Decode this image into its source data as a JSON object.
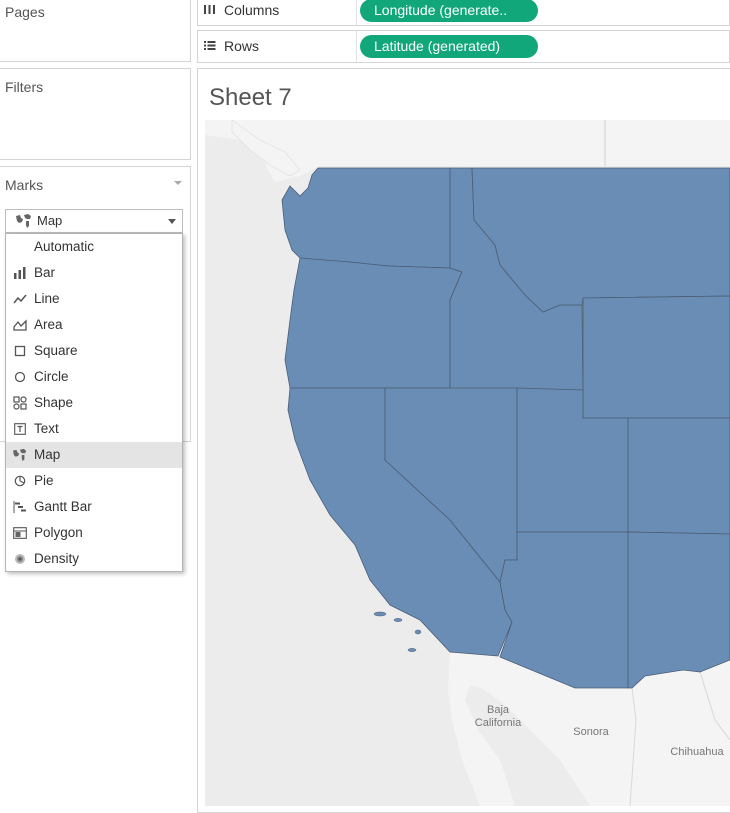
{
  "pages": {
    "title": "Pages"
  },
  "filters": {
    "title": "Filters"
  },
  "marks": {
    "title": "Marks",
    "selected": "Map",
    "menu_items": [
      {
        "label": "Automatic",
        "icon": "none"
      },
      {
        "label": "Bar",
        "icon": "bar-icon"
      },
      {
        "label": "Line",
        "icon": "line-icon"
      },
      {
        "label": "Area",
        "icon": "area-icon"
      },
      {
        "label": "Square",
        "icon": "square-icon"
      },
      {
        "label": "Circle",
        "icon": "circle-icon"
      },
      {
        "label": "Shape",
        "icon": "shape-icon"
      },
      {
        "label": "Text",
        "icon": "text-icon"
      },
      {
        "label": "Map",
        "icon": "map-icon"
      },
      {
        "label": "Pie",
        "icon": "pie-icon"
      },
      {
        "label": "Gantt Bar",
        "icon": "gantt-icon"
      },
      {
        "label": "Polygon",
        "icon": "polygon-icon"
      },
      {
        "label": "Density",
        "icon": "density-icon"
      }
    ]
  },
  "shelves": {
    "columns": {
      "label": "Columns",
      "pill": "Longitude (generate.."
    },
    "rows": {
      "label": "Rows",
      "pill": "Latitude (generated)"
    }
  },
  "sheet": {
    "title": "Sheet 7"
  },
  "map": {
    "labels": {
      "baja": "Baja\nCalifornia",
      "sonora": "Sonora",
      "chihuahua": "Chihuahua"
    },
    "colors": {
      "state_fill": "#6a8db5",
      "land": "#f2f2f2",
      "water": "#ececec",
      "pill": "#12a77b"
    }
  }
}
